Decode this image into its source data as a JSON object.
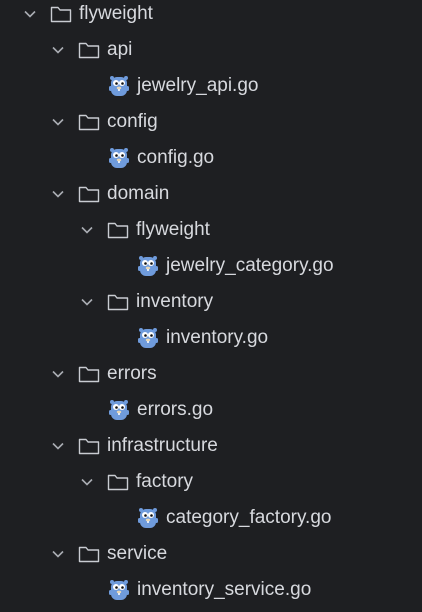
{
  "tree": {
    "nodes": [
      {
        "label": "flyweight",
        "type": "folder"
      },
      {
        "label": "api",
        "type": "folder"
      },
      {
        "label": "jewelry_api.go",
        "type": "file"
      },
      {
        "label": "config",
        "type": "folder"
      },
      {
        "label": "config.go",
        "type": "file"
      },
      {
        "label": "domain",
        "type": "folder"
      },
      {
        "label": "flyweight",
        "type": "folder"
      },
      {
        "label": "jewelry_category.go",
        "type": "file"
      },
      {
        "label": "inventory",
        "type": "folder"
      },
      {
        "label": "inventory.go",
        "type": "file"
      },
      {
        "label": "errors",
        "type": "folder"
      },
      {
        "label": "errors.go",
        "type": "file"
      },
      {
        "label": "infrastructure",
        "type": "folder"
      },
      {
        "label": "factory",
        "type": "folder"
      },
      {
        "label": "category_factory.go",
        "type": "file"
      },
      {
        "label": "service",
        "type": "folder"
      },
      {
        "label": "inventory_service.go",
        "type": "file"
      }
    ]
  },
  "icons": {
    "folder": "folder-outline-icon",
    "file": "go-gopher-icon",
    "expander": "chevron-down-icon"
  },
  "colors": {
    "background": "#1e1f22",
    "text": "#d7d9de",
    "chevron": "#a9acb3",
    "folder_outline": "#c9ccd2",
    "gopher_body": "#6f9bdc"
  }
}
